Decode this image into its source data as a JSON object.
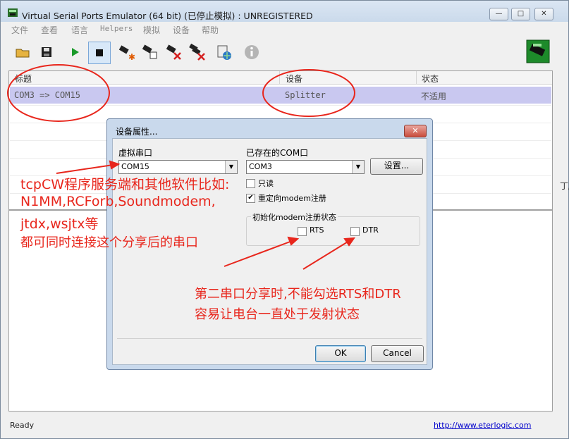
{
  "window": {
    "title": "Virtual Serial Ports Emulator (64 bit) (已停止模拟) : UNREGISTERED",
    "controls": [
      "—",
      "□",
      "✕"
    ]
  },
  "menu": [
    "文件",
    "查看",
    "语言",
    "Helpers",
    "模拟",
    "设备",
    "帮助"
  ],
  "toolbar_icons": [
    "open-folder-icon",
    "save-icon",
    "play-icon",
    "stop-icon",
    "new-device-icon",
    "device-properties-icon",
    "delete-device-icon",
    "delete-all-devices-icon",
    "network-device-icon",
    "info-icon",
    "registration-icon"
  ],
  "list": {
    "columns": [
      "标题",
      "设备",
      "状态"
    ],
    "rows": [
      {
        "title": "COM3 => COM15",
        "device": "Splitter",
        "status": "不适用"
      }
    ]
  },
  "status": {
    "text": "Ready",
    "link": "http://www.eterlogic.com"
  },
  "dialog": {
    "title": "设备属性...",
    "virtual_port_label": "虚拟串口",
    "virtual_port_value": "COM15",
    "existing_port_label": "已存在的COM口",
    "existing_port_value": "COM3",
    "settings_button": "设置...",
    "readonly_label": "只读",
    "readonly_checked": false,
    "redirect_label": "重定向modem注册",
    "redirect_checked": true,
    "group_label": "初始化modem注册状态",
    "rts_label": "RTS",
    "dtr_label": "DTR",
    "ok": "OK",
    "cancel": "Cancel"
  },
  "annotations": {
    "left_1": "tcpCW程序服务端和其他软件比如:",
    "left_2": "N1MM,RCForb,Soundmodem,",
    "left_3": "jtdx,wsjtx等",
    "left_4": "都可同时连接这个分享后的串口",
    "right_1": "第二串口分享时,不能勾选RTS和DTR",
    "right_2": "容易让电台一直处于发射状态"
  },
  "colors": {
    "annotation": "#e8261c",
    "selected_row": "#c9c8f0",
    "titlebar": "#dbe6f3"
  }
}
